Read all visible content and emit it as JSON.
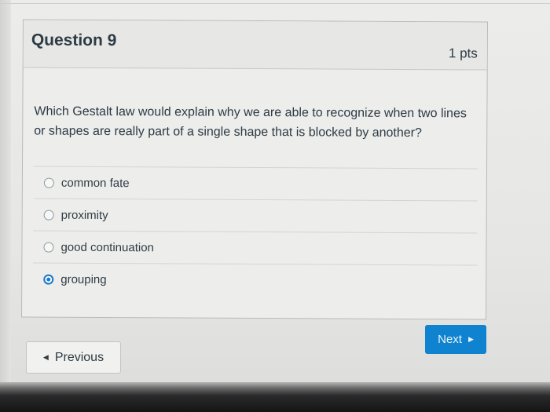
{
  "question": {
    "title": "Question 9",
    "points": "1 pts",
    "text": "Which Gestalt law would explain why we are able to recognize when two lines or shapes are really part of a single shape that is blocked by another?"
  },
  "answers": [
    {
      "label": "common fate",
      "selected": false
    },
    {
      "label": "proximity",
      "selected": false
    },
    {
      "label": "good continuation",
      "selected": false
    },
    {
      "label": "grouping",
      "selected": true
    }
  ],
  "navigation": {
    "next_label": "Next",
    "previous_label": "Previous"
  },
  "colors": {
    "accent": "#0f83cf",
    "text": "#2d3b45"
  },
  "icons": {
    "next": "caret-right-icon",
    "previous": "caret-left-icon"
  }
}
